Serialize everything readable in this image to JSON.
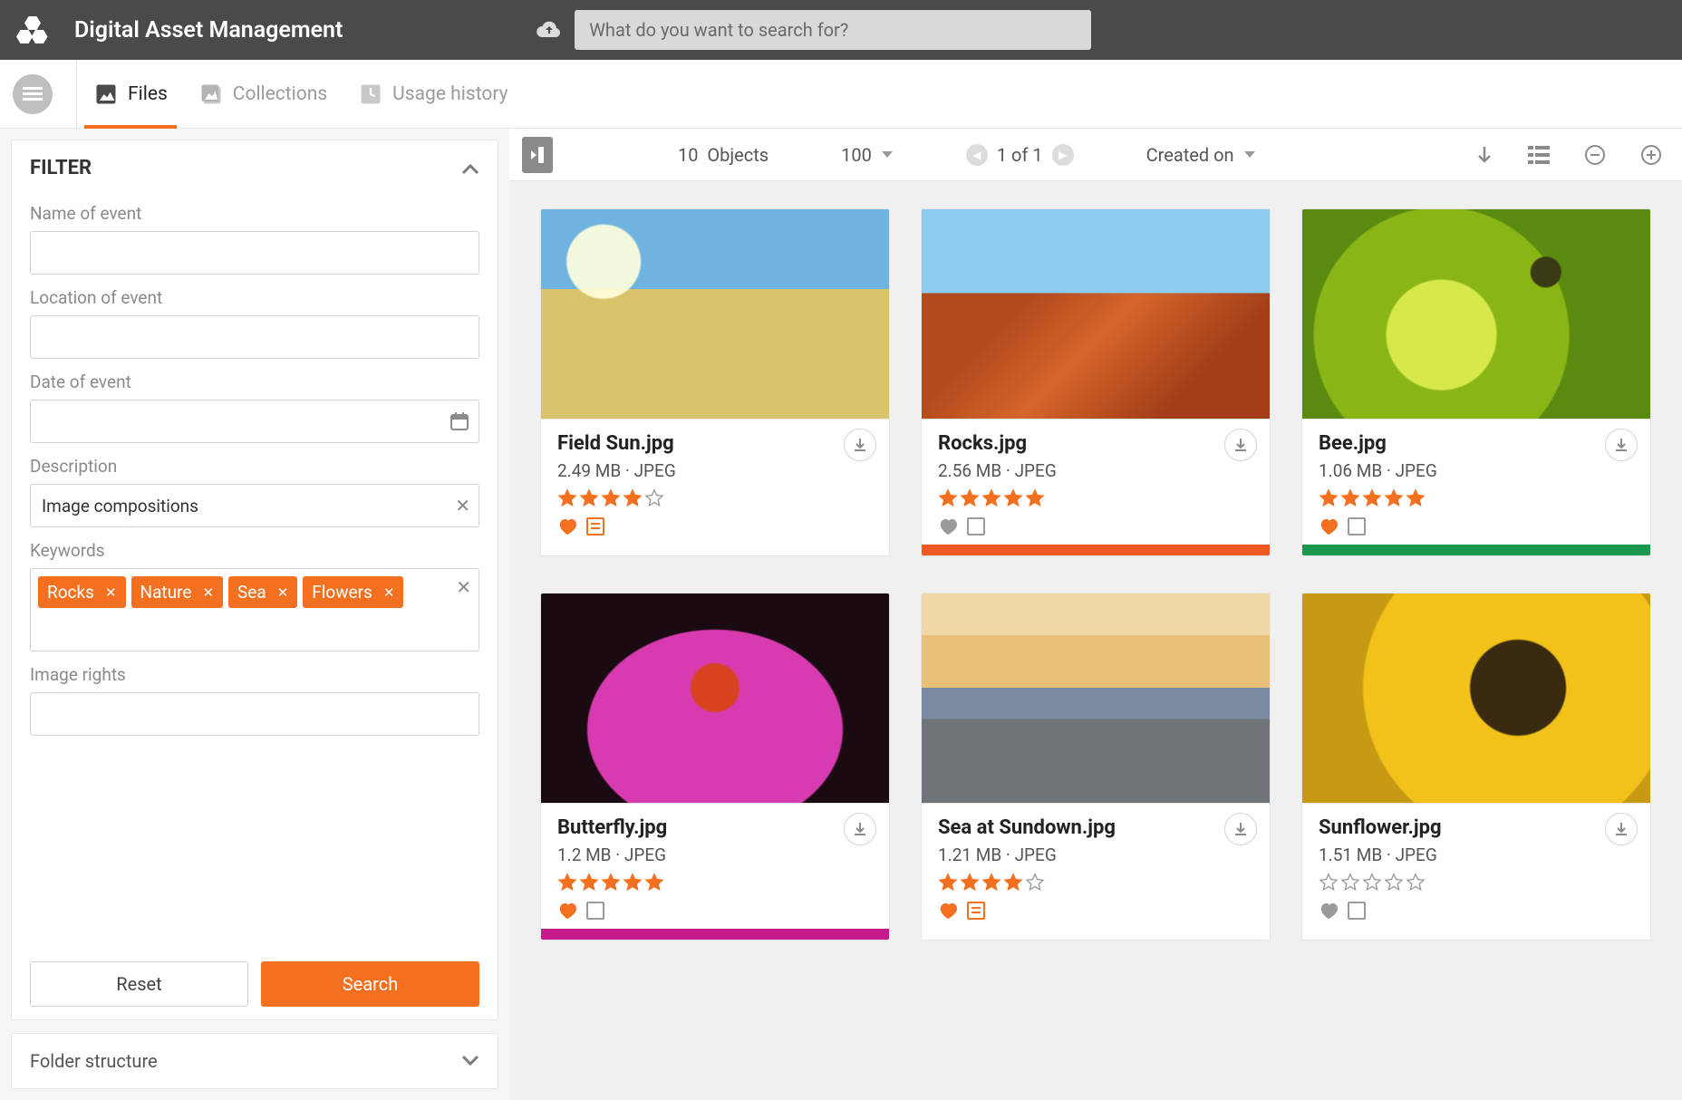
{
  "header": {
    "app_title": "Digital Asset Management",
    "search_placeholder": "What do you want to search for?"
  },
  "tabs": [
    {
      "label": "Files",
      "active": true
    },
    {
      "label": "Collections",
      "active": false
    },
    {
      "label": "Usage history",
      "active": false
    }
  ],
  "filter": {
    "title": "FILTER",
    "fields": {
      "name_label": "Name of event",
      "name_value": "",
      "location_label": "Location of event",
      "location_value": "",
      "date_label": "Date of event",
      "date_value": "",
      "description_label": "Description",
      "description_value": "Image compositions",
      "keywords_label": "Keywords",
      "rights_label": "Image rights",
      "rights_value": ""
    },
    "keywords": [
      "Rocks",
      "Nature",
      "Sea",
      "Flowers"
    ],
    "reset_label": "Reset",
    "search_label": "Search"
  },
  "folder_panel": {
    "title": "Folder structure"
  },
  "toolbar": {
    "count": "10",
    "objects_label": "Objects",
    "per_page": "100",
    "page_text": "1 of 1",
    "sort_label": "Created on"
  },
  "assets": [
    {
      "name": "Field Sun.jpg",
      "size": "2.49 MB",
      "format": "JPEG",
      "rating": 4,
      "favorite": true,
      "note_style": "orange",
      "stripe": "",
      "thumb": "th-field"
    },
    {
      "name": "Rocks.jpg",
      "size": "2.56 MB",
      "format": "JPEG",
      "rating": 5,
      "favorite": false,
      "note_style": "grey",
      "stripe": "#f05a22",
      "thumb": "th-rocks"
    },
    {
      "name": "Bee.jpg",
      "size": "1.06 MB",
      "format": "JPEG",
      "rating": 5,
      "favorite": true,
      "note_style": "grey",
      "stripe": "#1a9850",
      "thumb": "th-bee"
    },
    {
      "name": "Butterfly.jpg",
      "size": "1.2 MB",
      "format": "JPEG",
      "rating": 5,
      "favorite": true,
      "note_style": "grey",
      "stripe": "#c51b8a",
      "thumb": "th-butterfly"
    },
    {
      "name": "Sea at Sundown.jpg",
      "size": "1.21 MB",
      "format": "JPEG",
      "rating": 4,
      "favorite": true,
      "note_style": "orange",
      "stripe": "",
      "thumb": "th-sea"
    },
    {
      "name": "Sunflower.jpg",
      "size": "1.51 MB",
      "format": "JPEG",
      "rating": 0,
      "favorite": false,
      "note_style": "grey",
      "stripe": "",
      "thumb": "th-sunflower"
    }
  ],
  "colors": {
    "accent": "#f37021"
  }
}
